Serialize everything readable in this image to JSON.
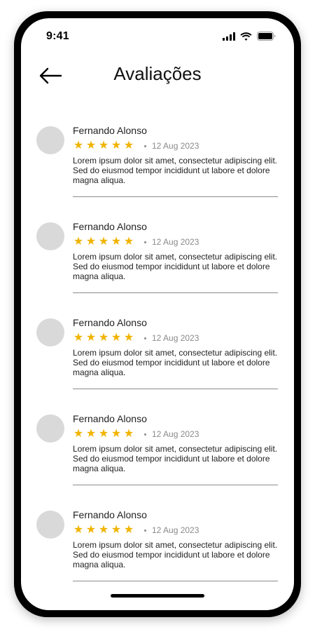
{
  "status_bar": {
    "time": "9:41",
    "icons": [
      "cellular-signal-icon",
      "wifi-icon",
      "battery-icon"
    ]
  },
  "header": {
    "title": "Avaliações",
    "back_icon": "arrow-left-icon"
  },
  "colors": {
    "star": "#f0b400",
    "avatar_placeholder": "#d9d9d9",
    "muted_text": "#8a8a8a"
  },
  "reviews": [
    {
      "name": "Fernando Alonso",
      "rating": 5,
      "date": "12 Aug 2023",
      "text": "Lorem ipsum dolor sit amet, consectetur adipiscing elit. Sed do eiusmod tempor incididunt ut labore et dolore magna aliqua."
    },
    {
      "name": "Fernando Alonso",
      "rating": 5,
      "date": "12 Aug 2023",
      "text": "Lorem ipsum dolor sit amet, consectetur adipiscing elit. Sed do eiusmod tempor incididunt ut labore et dolore magna aliqua."
    },
    {
      "name": "Fernando Alonso",
      "rating": 5,
      "date": "12 Aug 2023",
      "text": "Lorem ipsum dolor sit amet, consectetur adipiscing elit. Sed do eiusmod tempor incididunt ut labore et dolore magna aliqua."
    },
    {
      "name": "Fernando Alonso",
      "rating": 5,
      "date": "12 Aug 2023",
      "text": "Lorem ipsum dolor sit amet, consectetur adipiscing elit. Sed do eiusmod tempor incididunt ut labore et dolore magna aliqua."
    },
    {
      "name": "Fernando Alonso",
      "rating": 5,
      "date": "12 Aug 2023",
      "text": "Lorem ipsum dolor sit amet, consectetur adipiscing elit. Sed do eiusmod tempor incididunt ut labore et dolore magna aliqua."
    }
  ]
}
